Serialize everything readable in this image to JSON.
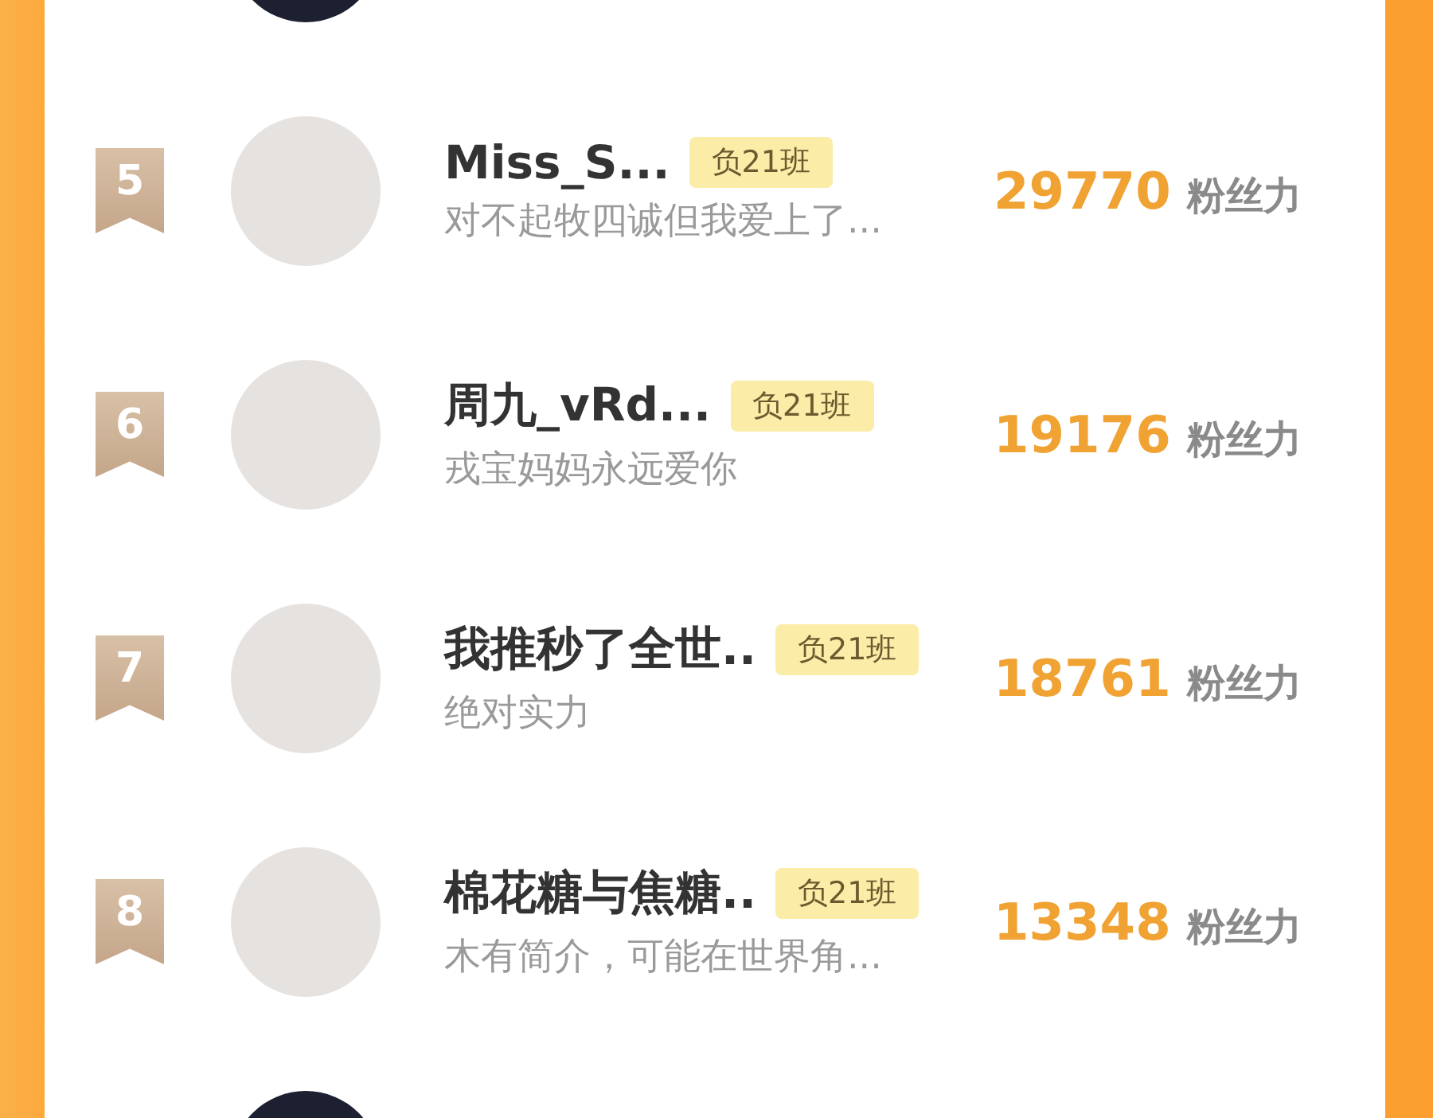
{
  "rows": [
    {
      "rank": "5",
      "name": "Miss_S...",
      "tag": "负21班",
      "bio": "对不起牧四诚但我爱上了...",
      "score": "29770",
      "score_unit": "粉丝力"
    },
    {
      "rank": "6",
      "name": "周九_vRd...",
      "tag": "负21班",
      "bio": "戎宝妈妈永远爱你",
      "score": "19176",
      "score_unit": "粉丝力"
    },
    {
      "rank": "7",
      "name": "我推秒了全世..",
      "tag": "负21班",
      "bio": "绝对实力",
      "score": "18761",
      "score_unit": "粉丝力"
    },
    {
      "rank": "8",
      "name": "棉花糖与焦糖..",
      "tag": "负21班",
      "bio": "木有简介，可能在世界角...",
      "score": "13348",
      "score_unit": "粉丝力"
    }
  ]
}
